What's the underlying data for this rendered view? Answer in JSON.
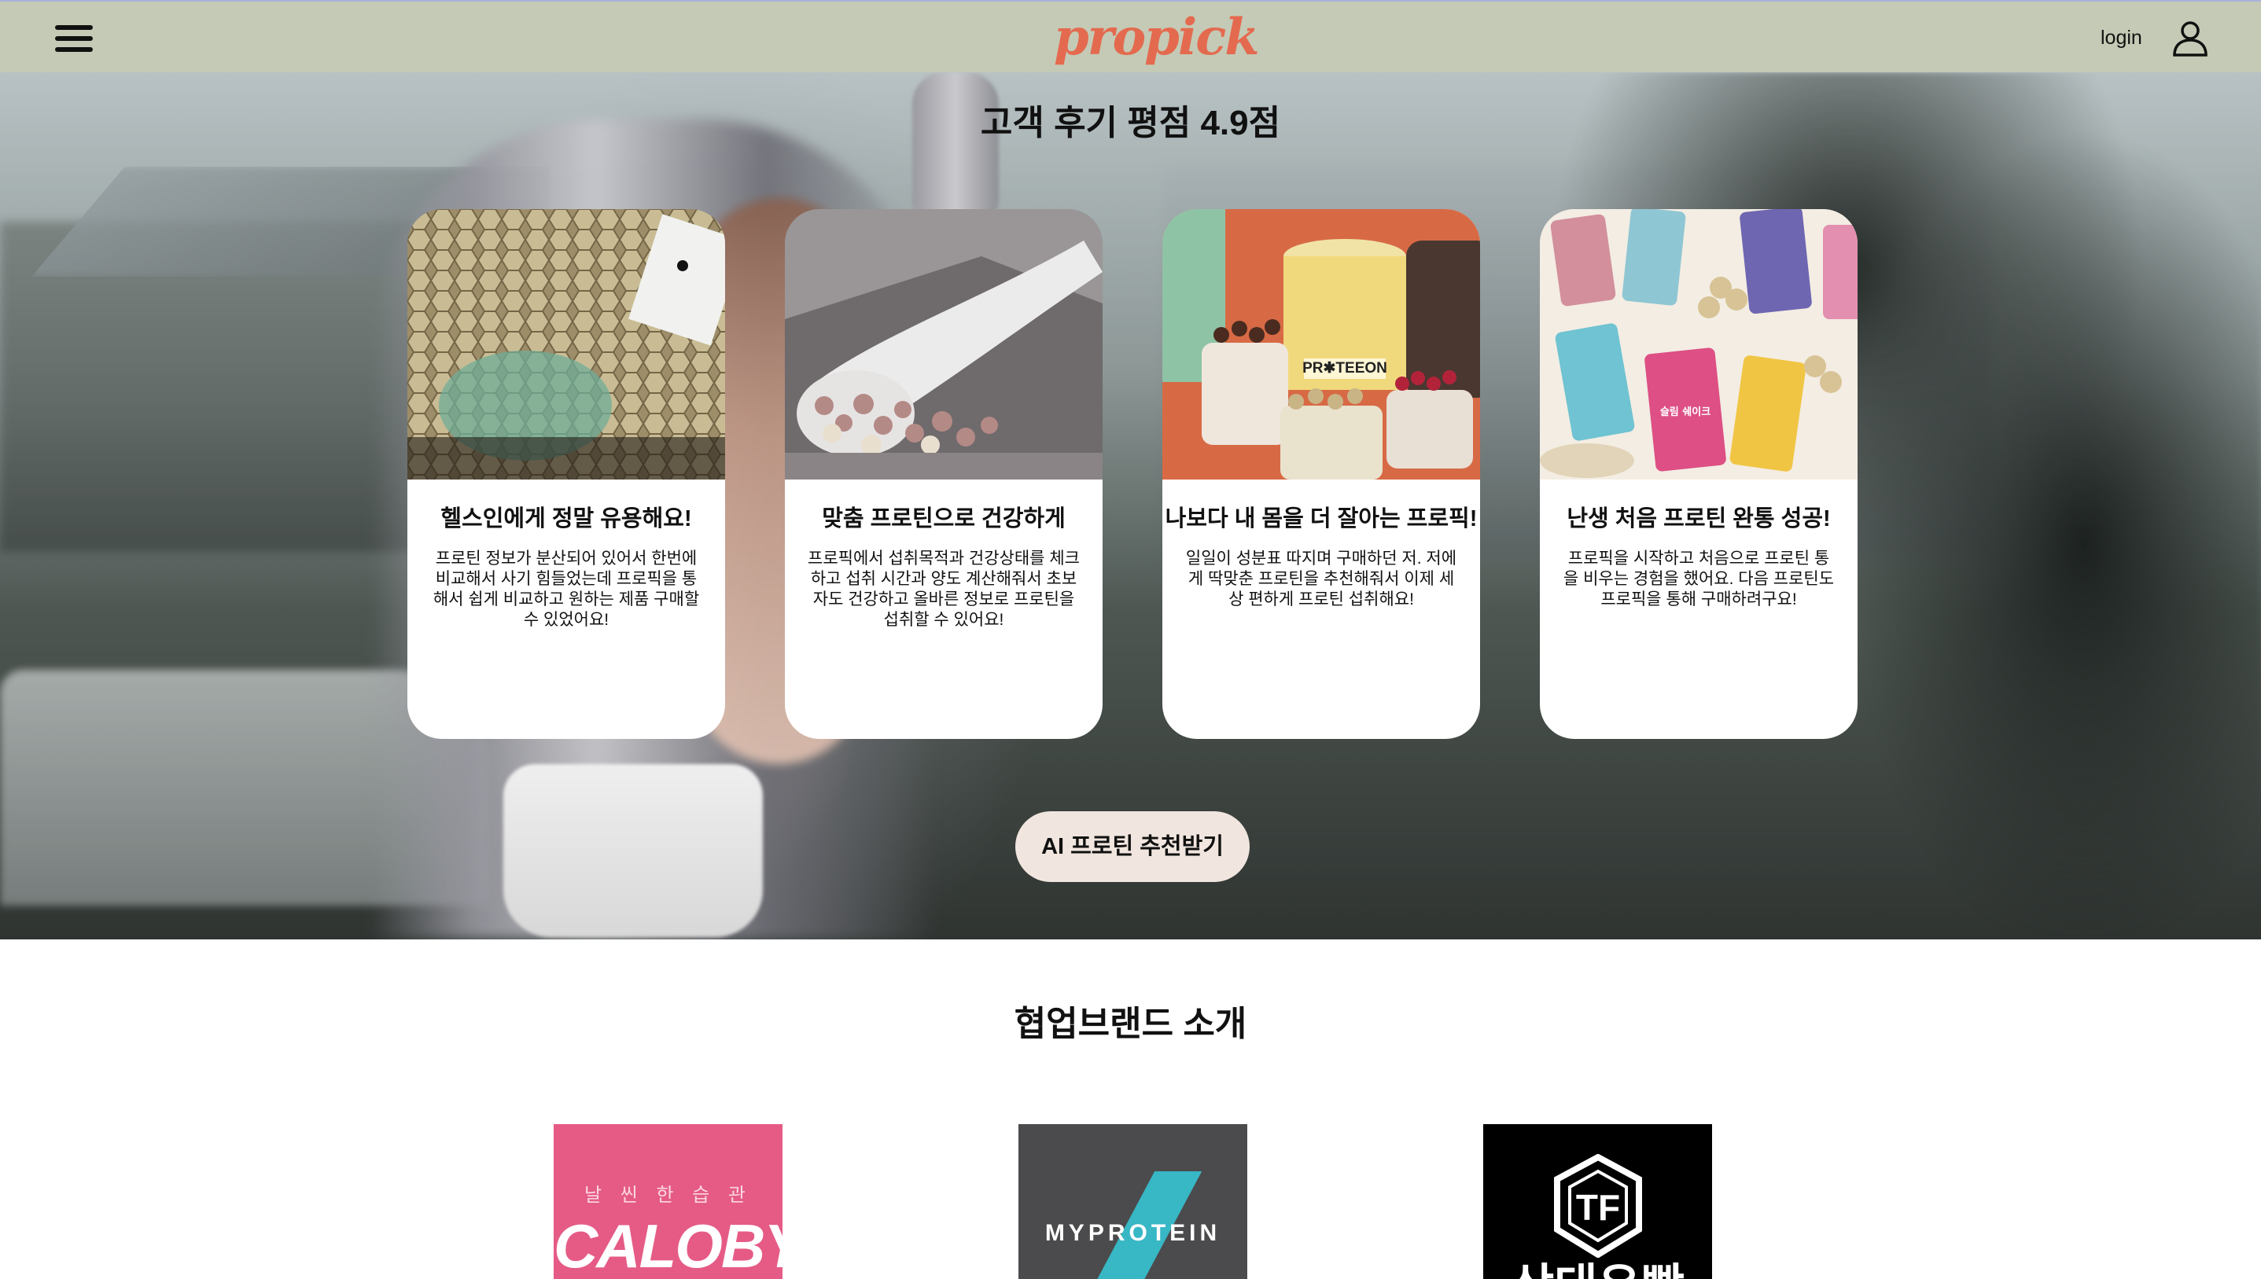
{
  "header": {
    "logo": "propick",
    "login_label": "login",
    "menu_icon": "hamburger-menu-icon",
    "user_icon": "user-icon",
    "background": "#c4cab5"
  },
  "hero": {
    "title": "고객 후기 평점 4.9점",
    "cards": [
      {
        "title": "헬스인에게 정말 유용해요!",
        "text": "프로틴 정보가 분산되어 있어서 한번에 비교해서 사기 힘들었는데 프로픽을 통해서 쉽게 비교하고 원하는 제품 구매할 수 있었어요!"
      },
      {
        "title": "맞춤 프로틴으로 건강하게",
        "text": "프로픽에서 섭취목적과 건강상태를 체크하고 섭취 시간과 양도 계산해줘서 초보자도 건강하고 올바른 정보로 프로틴을 섭취할 수 있어요!"
      },
      {
        "title": "나보다 내 몸을 더 잘아는 프로픽!",
        "text": "일일이 성분표 따지며 구매하던 저. 저에게 딱맞춘 프로틴을 추천해줘서 이제 세상 편하게 프로틴 섭취해요!",
        "image_label": "PR✱TEEON"
      },
      {
        "title": "난생 처음 프로틴 완통 성공!",
        "text": "프로픽을 시작하고 처음으로 프로틴 통을 비우는 경험을 했어요. 다음 프로틴도 프로픽을 통해 구매하려구요!",
        "image_label": "슬림 쉐이크"
      }
    ],
    "cta_label": "AI 프로틴 추천받기",
    "cta_color": "#f1e6df"
  },
  "brands": {
    "title": "협업브랜드 소개",
    "items": [
      {
        "sub": "날 씬 한 습 관",
        "name": "CALOBYE",
        "color": "#e55b86"
      },
      {
        "name": "MYPROTEIN",
        "color": "#4b4b4d",
        "accent": "#38b7c5"
      },
      {
        "name": "상대우빡",
        "mark": "TF",
        "color": "#000000"
      }
    ]
  }
}
